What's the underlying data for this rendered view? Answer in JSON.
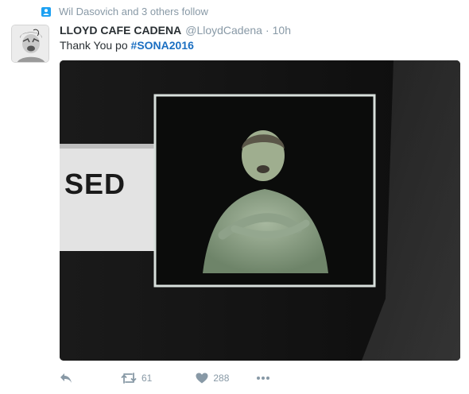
{
  "context": {
    "text": "Wil Dasovich and 3 others follow"
  },
  "tweet": {
    "fullname": "LLOYD CAFE CADENA",
    "username": "@LloydCadena",
    "separator": "·",
    "time": "10h",
    "text_prefix": "Thank You po ",
    "hashtag": "#SONA2016"
  },
  "media": {
    "screen_text": "SED"
  },
  "actions": {
    "retweet_count": "61",
    "like_count": "288"
  },
  "colors": {
    "link": "#1b6fc2",
    "secondary": "#8899a6",
    "accent": "#1da1f2"
  },
  "icons": [
    "person-icon",
    "reply-icon",
    "retweet-icon",
    "heart-icon",
    "more-icon"
  ]
}
